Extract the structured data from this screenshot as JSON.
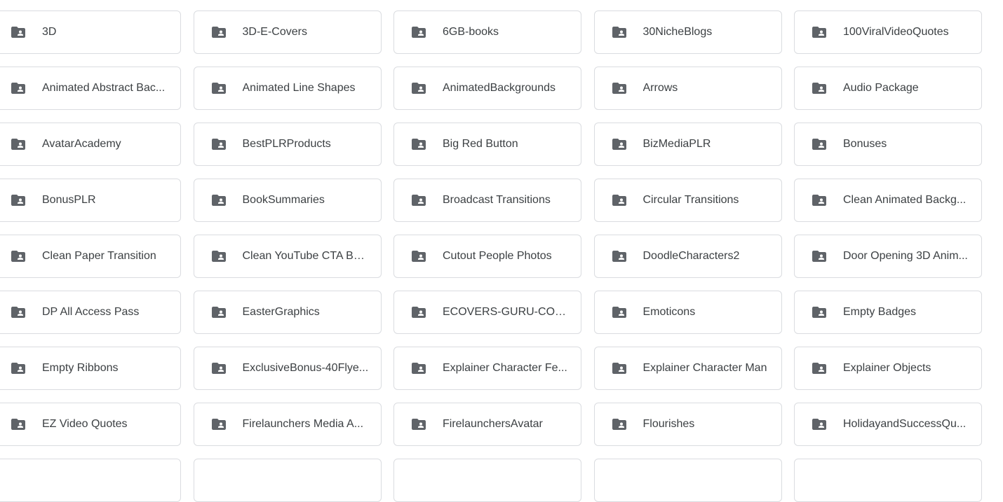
{
  "folders": [
    {
      "name": "3D"
    },
    {
      "name": "3D-E-Covers"
    },
    {
      "name": "6GB-books"
    },
    {
      "name": "30NicheBlogs"
    },
    {
      "name": "100ViralVideoQuotes"
    },
    {
      "name": "Animated Abstract Bac..."
    },
    {
      "name": "Animated Line Shapes"
    },
    {
      "name": "AnimatedBackgrounds"
    },
    {
      "name": "Arrows"
    },
    {
      "name": "Audio Package"
    },
    {
      "name": "AvatarAcademy"
    },
    {
      "name": "BestPLRProducts"
    },
    {
      "name": "Big Red Button"
    },
    {
      "name": "BizMediaPLR"
    },
    {
      "name": "Bonuses"
    },
    {
      "name": "BonusPLR"
    },
    {
      "name": "BookSummaries"
    },
    {
      "name": "Broadcast Transitions"
    },
    {
      "name": "Circular Transitions"
    },
    {
      "name": "Clean Animated Backg..."
    },
    {
      "name": "Clean Paper Transition"
    },
    {
      "name": "Clean YouTube CTA Bu..."
    },
    {
      "name": "Cutout People Photos"
    },
    {
      "name": "DoodleCharacters2"
    },
    {
      "name": "Door Opening 3D Anim..."
    },
    {
      "name": "DP All Access Pass"
    },
    {
      "name": "EasterGraphics"
    },
    {
      "name": "ECOVERS-GURU-COLL..."
    },
    {
      "name": "Emoticons"
    },
    {
      "name": "Empty Badges"
    },
    {
      "name": "Empty Ribbons"
    },
    {
      "name": "ExclusiveBonus-40Flye..."
    },
    {
      "name": "Explainer Character Fe..."
    },
    {
      "name": "Explainer Character Man"
    },
    {
      "name": "Explainer Objects"
    },
    {
      "name": "EZ Video Quotes"
    },
    {
      "name": "Firelaunchers Media A..."
    },
    {
      "name": "FirelaunchersAvatar"
    },
    {
      "name": "Flourishes"
    },
    {
      "name": "HolidayandSuccessQu..."
    }
  ],
  "icon": "shared-folder-icon",
  "colors": {
    "icon": "#5f6368",
    "text": "#3c4043",
    "border": "#dadce0"
  }
}
